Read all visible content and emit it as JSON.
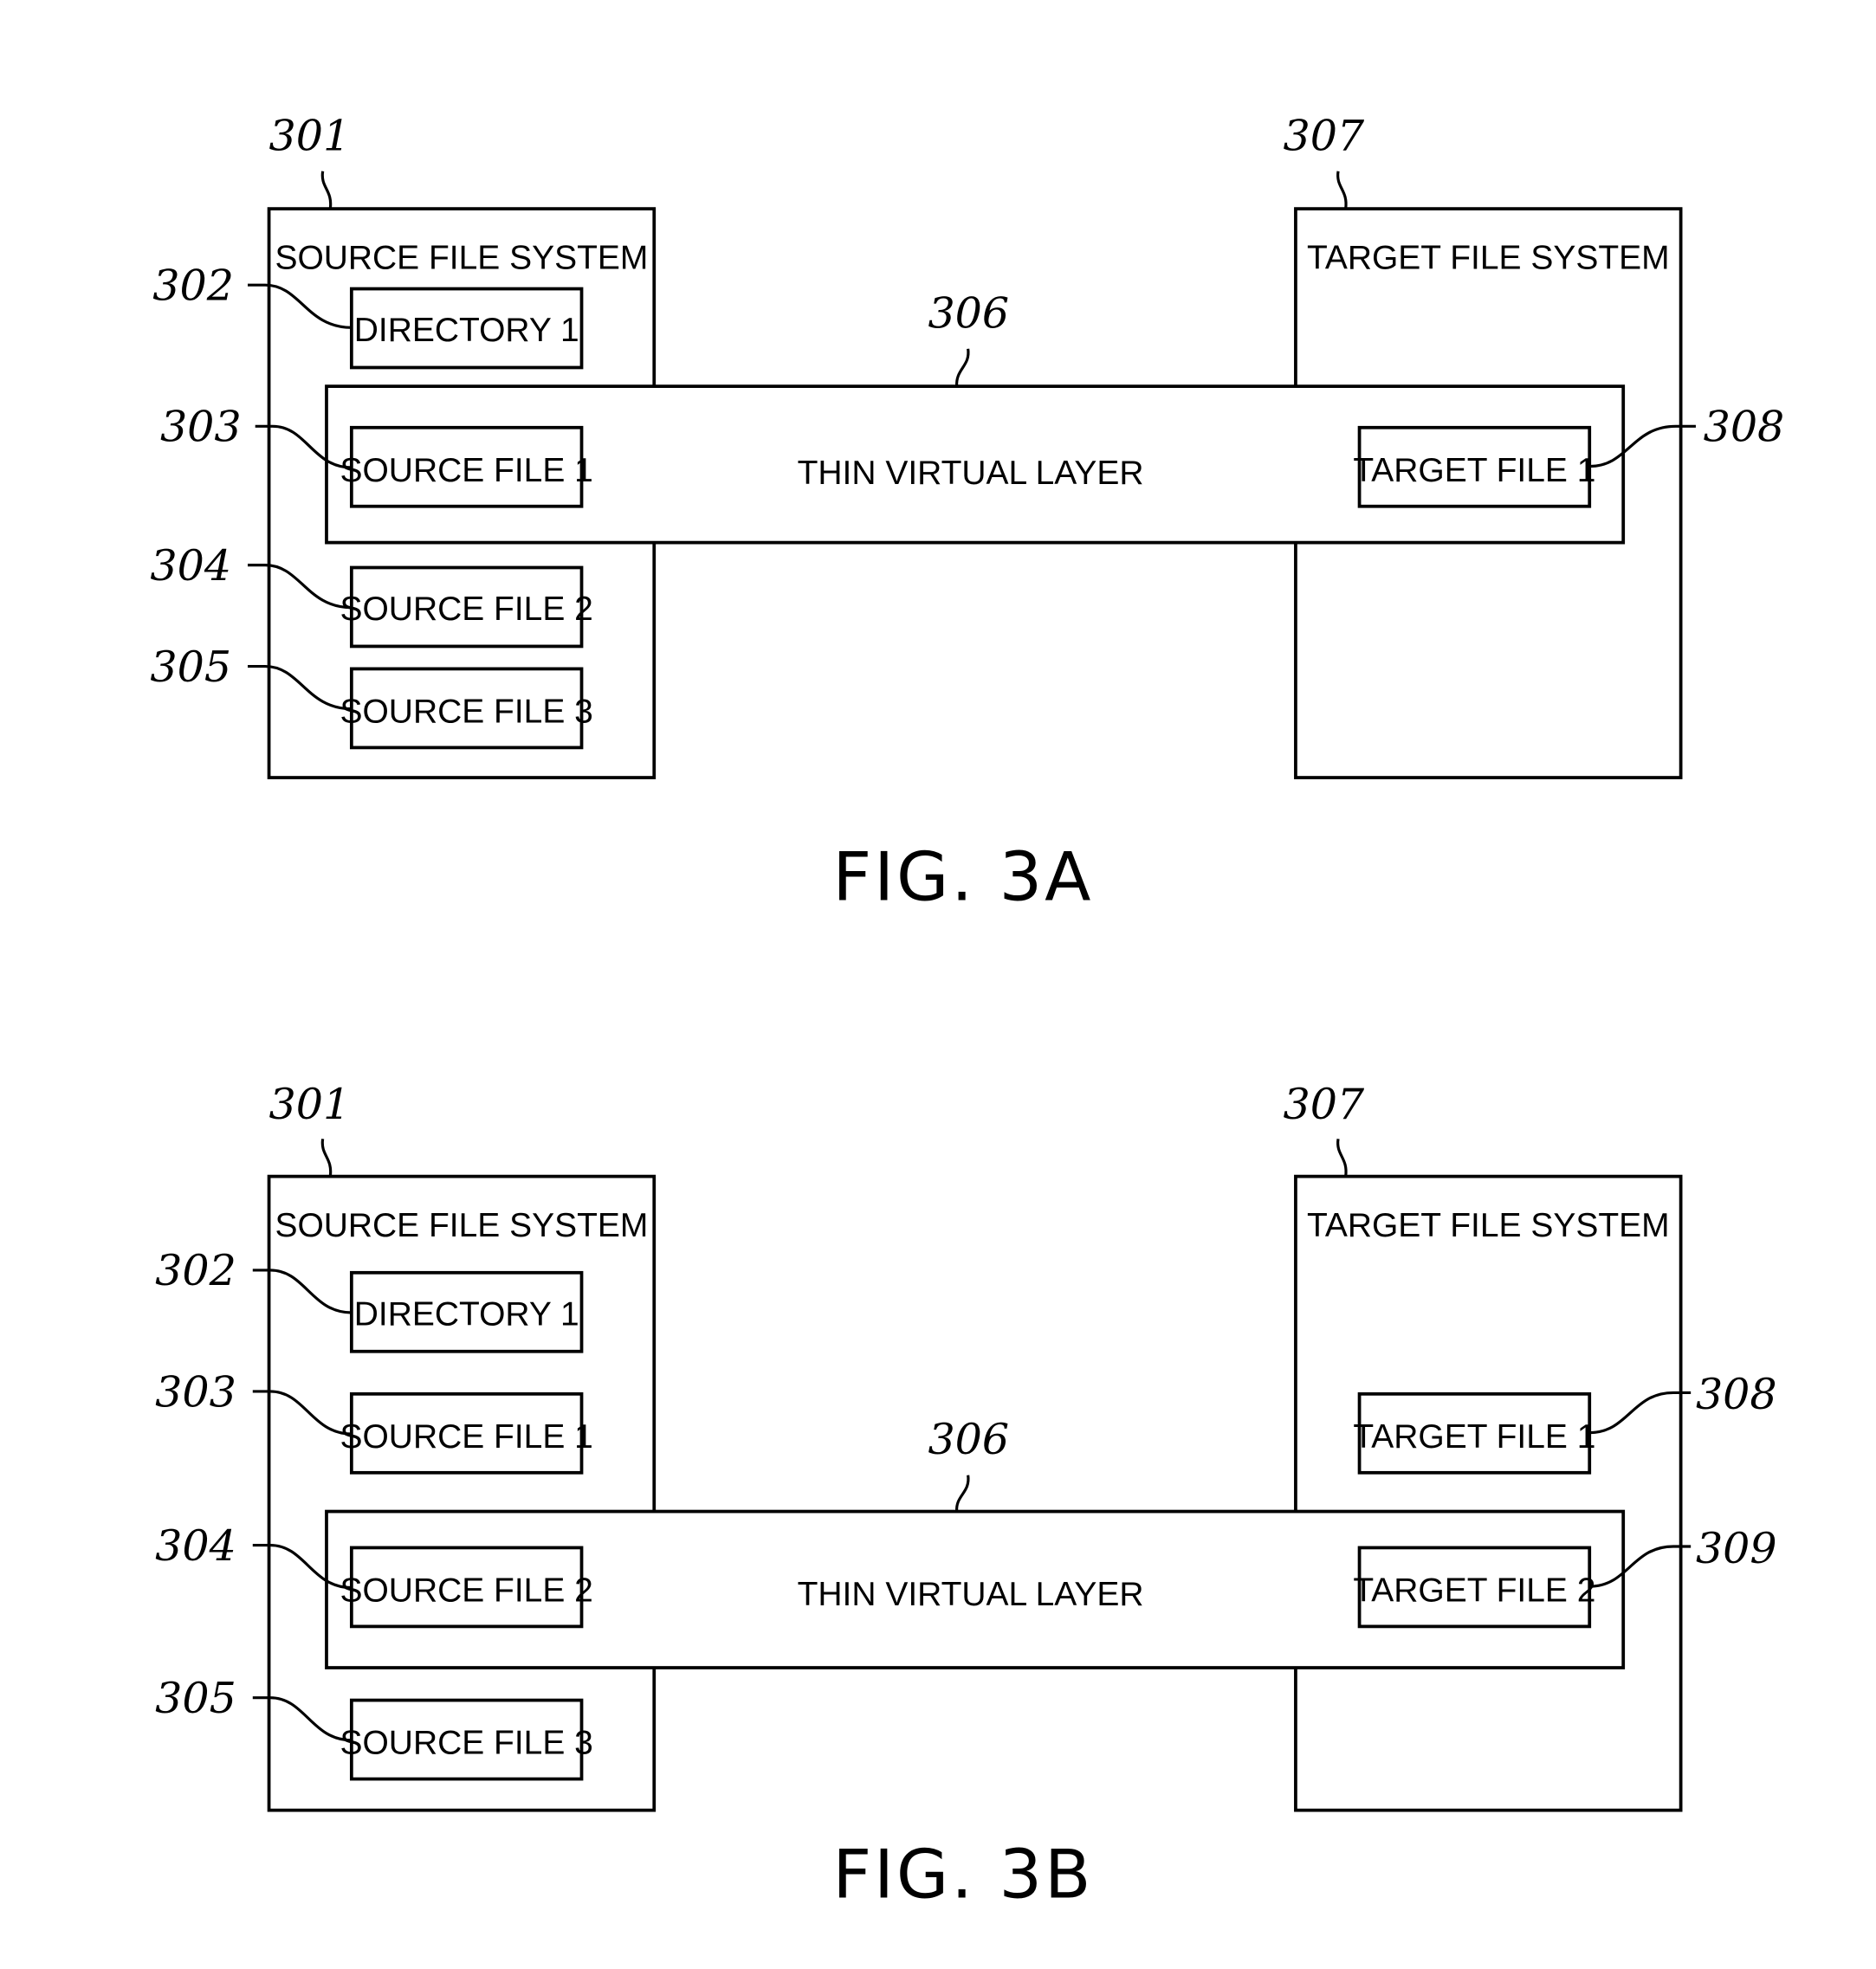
{
  "figures": [
    {
      "caption": "FIG. 3A",
      "source_fs": {
        "ref": "301",
        "title": "SOURCE FILE SYSTEM"
      },
      "target_fs": {
        "ref": "307",
        "title": "TARGET FILE SYSTEM"
      },
      "virtual_layer": {
        "ref": "306",
        "label": "THIN VIRTUAL LAYER"
      },
      "source_items": [
        {
          "ref": "302",
          "label": "DIRECTORY 1"
        },
        {
          "ref": "303",
          "label": "SOURCE FILE 1"
        },
        {
          "ref": "304",
          "label": "SOURCE FILE 2"
        },
        {
          "ref": "305",
          "label": "SOURCE FILE 3"
        }
      ],
      "target_items": [
        {
          "ref": "308",
          "label": "TARGET FILE 1"
        }
      ]
    },
    {
      "caption": "FIG. 3B",
      "source_fs": {
        "ref": "301",
        "title": "SOURCE FILE SYSTEM"
      },
      "target_fs": {
        "ref": "307",
        "title": "TARGET FILE SYSTEM"
      },
      "virtual_layer": {
        "ref": "306",
        "label": "THIN VIRTUAL LAYER"
      },
      "source_items": [
        {
          "ref": "302",
          "label": "DIRECTORY 1"
        },
        {
          "ref": "303",
          "label": "SOURCE FILE 1"
        },
        {
          "ref": "304",
          "label": "SOURCE FILE 2"
        },
        {
          "ref": "305",
          "label": "SOURCE FILE 3"
        }
      ],
      "target_items": [
        {
          "ref": "308",
          "label": "TARGET FILE 1"
        },
        {
          "ref": "309",
          "label": "TARGET FILE 2"
        }
      ]
    }
  ]
}
